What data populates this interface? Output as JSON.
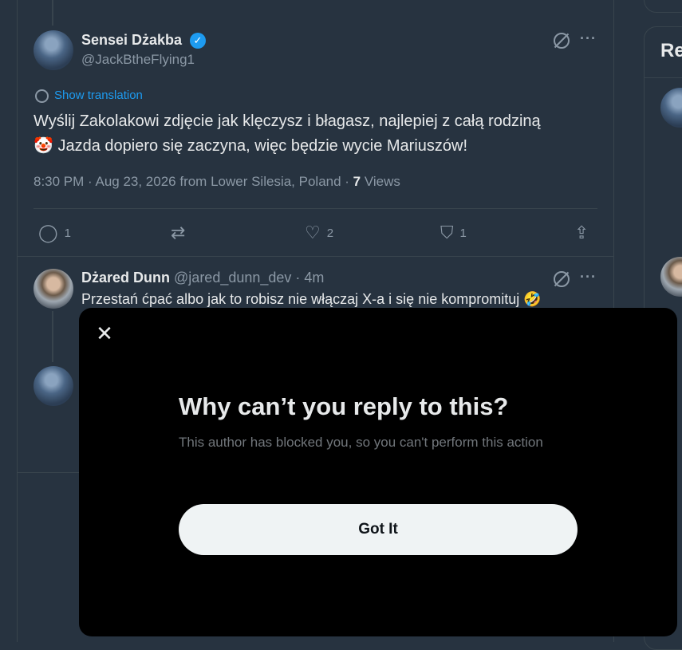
{
  "tweet": {
    "author_name": "Sensei Dżakba",
    "author_handle": "@JackBtheFlying1",
    "show_translation": "Show translation",
    "text_line1": "Wyślij Zakolakowi zdjęcie jak klęczysz i błagasz, najlepiej z całą rodziną",
    "text_line2": "Jazda dopiero się zaczyna, więc będzie wycie Mariuszów!",
    "emoji": "🤡",
    "meta_prefix": "8:30 PM · Aug 23, 2026 from Lower Silesia, Poland · ",
    "views_count": "7",
    "views_label": " Views",
    "reply_count": "1",
    "retweet_count": "",
    "like_count": "2",
    "bookmark_count": "1"
  },
  "reply": {
    "author_name": "Dżared Dunn",
    "author_handle": "@jared_dunn_dev · 4m",
    "text": "Przestań ćpać albo jak to robisz nie włączaj X-a i się nie kompromituj",
    "emoji": "🤣"
  },
  "sidebar": {
    "title_fragment": "Re"
  },
  "modal": {
    "close_symbol": "✕",
    "title": "Why can’t you reply to this?",
    "body": "This author has blocked you, so you can't perform this action",
    "button_label": "Got It"
  },
  "icons": {
    "grok": "grok-icon",
    "more": "more-icon",
    "reply": "reply-icon",
    "retweet": "retweet-icon",
    "like": "heart-icon",
    "bookmark": "bookmark-icon",
    "share": "share-icon"
  },
  "colors": {
    "background": "#273340",
    "accent": "#1d9bf0",
    "modal_bg": "#000000",
    "button_bg": "#eff3f4"
  }
}
